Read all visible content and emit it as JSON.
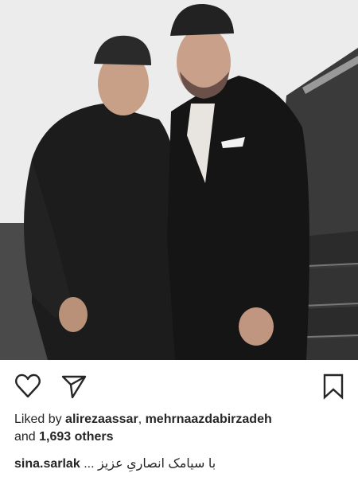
{
  "photo": {
    "alt_subject": "two-men-wearing-caps-indoors"
  },
  "actions": {
    "like_icon": "heart-icon",
    "share_icon": "paper-plane-icon",
    "save_icon": "bookmark-icon"
  },
  "likes": {
    "prefix": "Liked by ",
    "user1": "alirezaassar",
    "separator": ", ",
    "user2": "mehrnaazdabirzadeh",
    "and": "and ",
    "others_count": "1,693 others"
  },
  "caption": {
    "username": "sina.sarlak",
    "text": "با سیامک انصاریِ عزیز ..."
  },
  "colors": {
    "text": "#262626",
    "background": "#ffffff",
    "icon_stroke": "#262626"
  }
}
